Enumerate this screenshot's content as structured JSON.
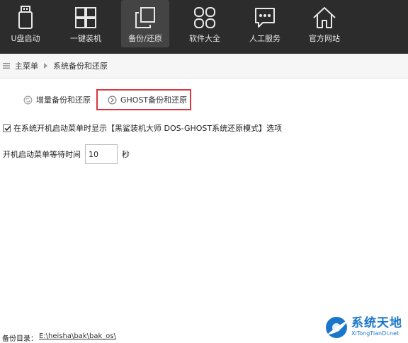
{
  "nav": {
    "items": [
      {
        "label": "U盘启动",
        "icon": "usb-drive-icon"
      },
      {
        "label": "一键装机",
        "icon": "windows-icon"
      },
      {
        "label": "备份/还原",
        "icon": "backup-restore-icon",
        "active": true
      },
      {
        "label": "软件大全",
        "icon": "apps-grid-icon"
      },
      {
        "label": "人工服务",
        "icon": "chat-icon"
      },
      {
        "label": "官方网站",
        "icon": "home-icon"
      }
    ]
  },
  "breadcrumb": {
    "home": "主菜单",
    "current": "系统备份和还原"
  },
  "tabs": {
    "incremental": "增量备份和还原",
    "ghost": "GHOST备份和还原"
  },
  "option": {
    "checked": true,
    "label": "在系统开机启动菜单时显示【黑鲨装机大师 DOS-GHOST系统还原模式】选项"
  },
  "wait": {
    "label": "开机启动菜单等待时间",
    "value": "10",
    "unit": "秒"
  },
  "backup": {
    "label": "备份目录：",
    "path": "E:\\heisha\\bak\\bak_os\\"
  },
  "watermark": {
    "main": "系统天地",
    "sub": "XiTongTianDi.net"
  },
  "colors": {
    "topbar": "#2c2c2c",
    "highlight_border": "#d9363e",
    "watermark": "#1a76c9"
  }
}
